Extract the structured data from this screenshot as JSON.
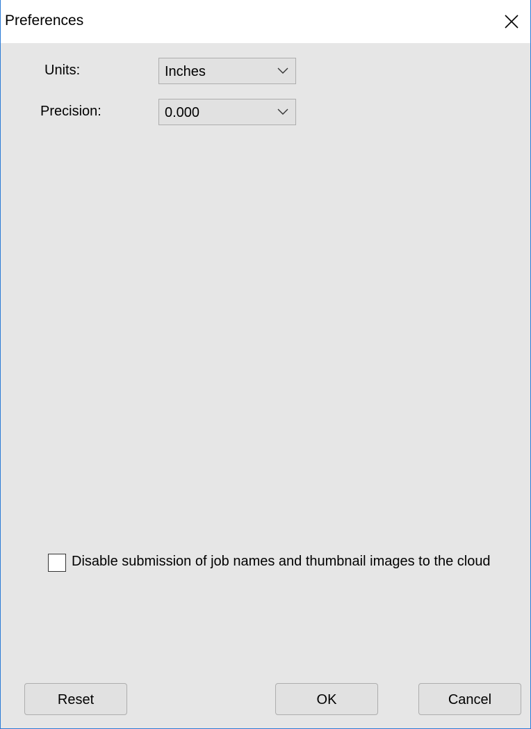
{
  "window": {
    "title": "Preferences"
  },
  "units": {
    "label": "Units:",
    "selected": "Inches"
  },
  "precision": {
    "label": "Precision:",
    "selected": "0.000"
  },
  "cloud_option": {
    "label": "Disable submission of job names and thumbnail images to the cloud",
    "checked": false
  },
  "buttons": {
    "reset_label": "Reset",
    "ok_label": "OK",
    "cancel_label": "Cancel"
  },
  "icons": {
    "close": "close-icon",
    "dropdown": "chevron-down-icon"
  },
  "colors": {
    "window_border": "#2b7bd6",
    "dialog_background": "#e6e6e6",
    "title_background": "#ffffff"
  }
}
